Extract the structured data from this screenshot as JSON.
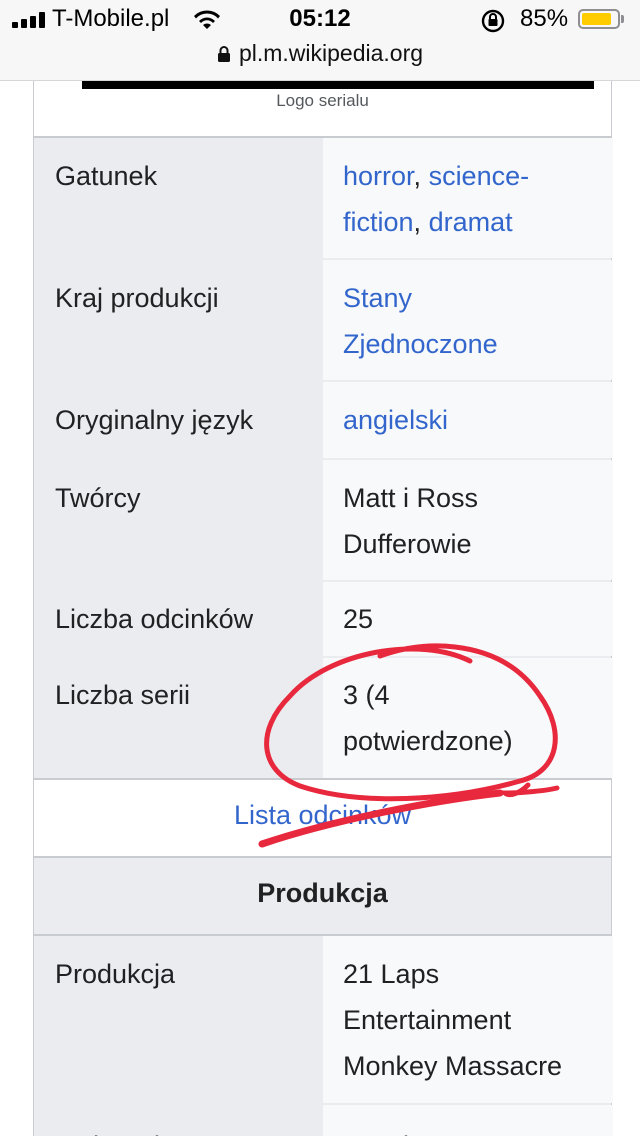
{
  "status": {
    "carrier": "T-Mobile.pl",
    "time": "05:12",
    "battery_percent": "85%",
    "battery_level": 0.85,
    "battery_color": "#ffcc00"
  },
  "address": {
    "url": "pl.m.wikipedia.org"
  },
  "infobox": {
    "logo_caption": "Logo serialu",
    "rows": [
      {
        "label": "Gatunek",
        "value_parts": [
          {
            "text": "horror",
            "link": true
          },
          {
            "text": ", ",
            "link": false
          },
          {
            "text": "science-fiction",
            "link": true
          },
          {
            "text": ", ",
            "link": false
          },
          {
            "text": "dramat",
            "link": true
          }
        ]
      },
      {
        "label": "Kraj produkcji",
        "value_parts": [
          {
            "text": "Stany Zjednoczone",
            "link": true
          }
        ]
      },
      {
        "label": "Oryginalny język",
        "value_parts": [
          {
            "text": "angielski",
            "link": true
          }
        ]
      },
      {
        "label": "Twórcy",
        "value_parts": [
          {
            "text": "Matt i Ross Dufferowie",
            "link": false
          }
        ]
      },
      {
        "label": "Liczba odcinków",
        "value_parts": [
          {
            "text": "25",
            "link": false
          }
        ]
      },
      {
        "label": "Liczba serii",
        "value_parts": [
          {
            "text": "3 (4 potwierdzone)",
            "link": false
          }
        ]
      }
    ],
    "episode_list_link": "Lista odcinków",
    "section_title": "Produkcja",
    "production_rows": [
      {
        "label": "Produkcja",
        "value_lines": [
          "21 Laps",
          "Entertainment",
          "Monkey Massacre"
        ]
      },
      {
        "label": "Reżyseria",
        "value_lines": [
          "Matt i Ross"
        ]
      }
    ]
  },
  "colors": {
    "link": "#3366cc",
    "annotation": "#e8283c",
    "label_bg": "#eaecf0",
    "value_bg": "#f8f9fa"
  }
}
